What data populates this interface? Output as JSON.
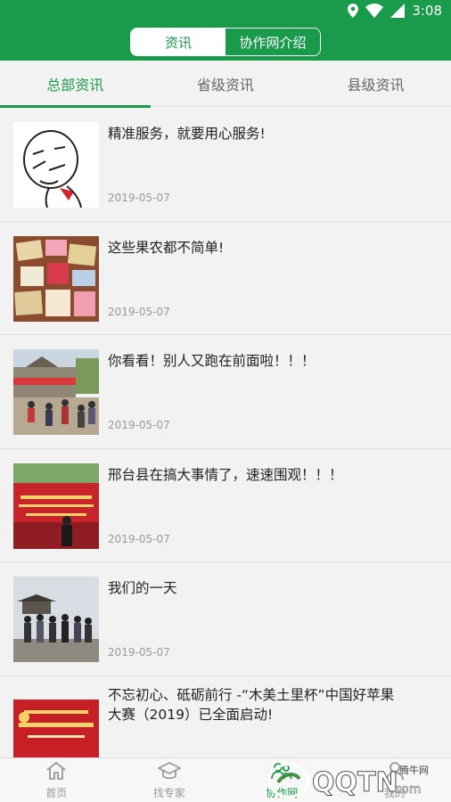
{
  "status_bar": {
    "time": "3:08"
  },
  "header": {
    "segments": [
      {
        "label": "资讯",
        "active": true
      },
      {
        "label": "协作网介绍",
        "active": false
      }
    ]
  },
  "subtabs": [
    {
      "label": "总部资讯",
      "active": true
    },
    {
      "label": "省级资讯",
      "active": false
    },
    {
      "label": "县级资讯",
      "active": false
    }
  ],
  "news": [
    {
      "title": "精准服务，就要用心服务!",
      "date": "2019-05-07"
    },
    {
      "title": "这些果农都不简单!",
      "date": "2019-05-07"
    },
    {
      "title": "你看看！别人又跑在前面啦！！！",
      "date": "2019-05-07"
    },
    {
      "title": "邢台县在搞大事情了，速速围观！！！",
      "date": "2019-05-07"
    },
    {
      "title": "我们的一天",
      "date": "2019-05-07"
    },
    {
      "title": "不忘初心、砥砺前行 -“木美土里杯”中国好苹果大赛（2019）已全面启动!",
      "date": ""
    }
  ],
  "bottom_nav": [
    {
      "label": "首页",
      "icon": "home-icon",
      "active": false
    },
    {
      "label": "找专家",
      "icon": "graduation-cap-icon",
      "active": false
    },
    {
      "label": "协作网",
      "icon": "collab-icon",
      "active": true
    },
    {
      "label": "我的",
      "icon": "user-icon",
      "active": false
    }
  ],
  "watermark": {
    "text": "QQTN.com",
    "subtext": "腾牛网"
  },
  "colors": {
    "primary": "#1a9a4b",
    "background": "#f2f2f2"
  }
}
